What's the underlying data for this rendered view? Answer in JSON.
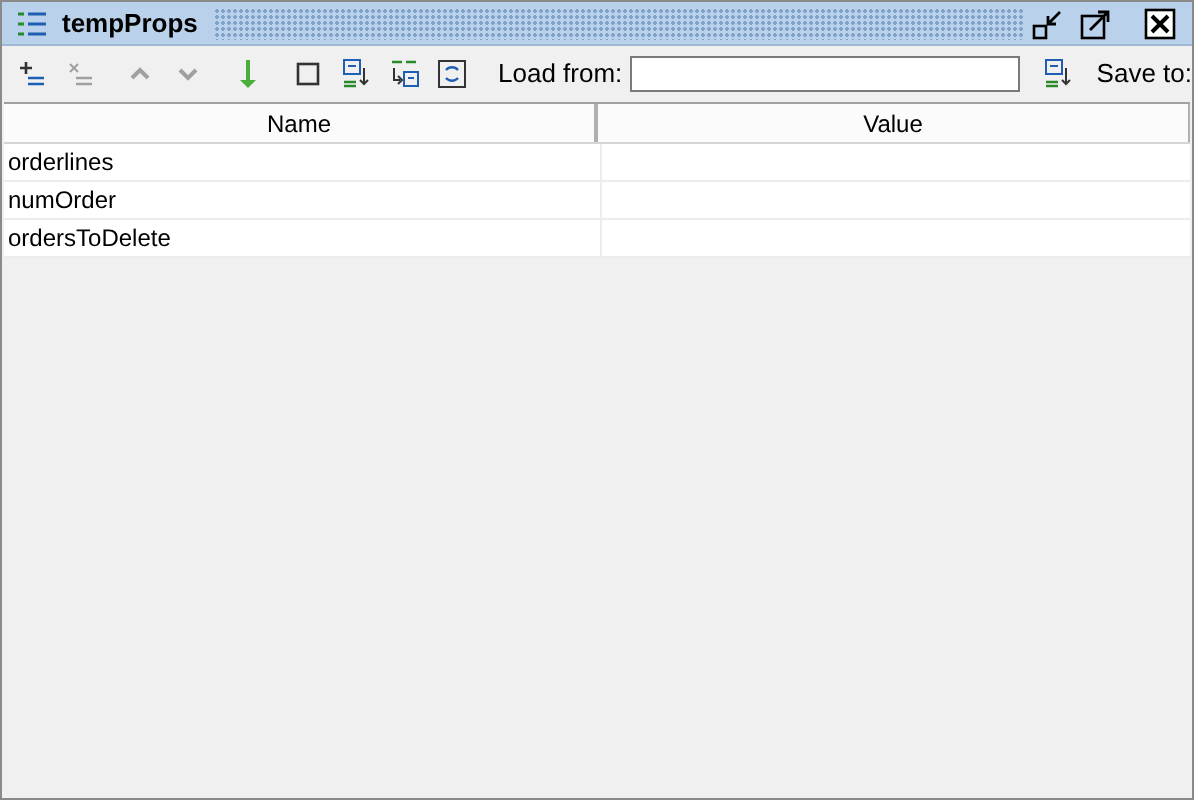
{
  "window": {
    "title": "tempProps"
  },
  "toolbar": [
    {
      "kind": "add",
      "disabled": false
    },
    {
      "kind": "remove",
      "disabled": true
    },
    {
      "kind": "up",
      "disabled": true
    },
    {
      "kind": "down",
      "disabled": true
    },
    {
      "kind": "download",
      "disabled": false
    },
    {
      "kind": "square",
      "disabled": false
    },
    {
      "kind": "load",
      "disabled": false
    },
    {
      "kind": "swap",
      "disabled": false
    },
    {
      "kind": "refresh",
      "disabled": false
    }
  ],
  "load_from": {
    "label": "Load from:"
  },
  "save_to": {
    "label": "Save to:"
  },
  "table": {
    "columns": [
      "Name",
      "Value"
    ],
    "rows": [
      {
        "name": "orderlines"
      },
      {
        "name": "numOrder"
      },
      {
        "name": "ordersToDelete"
      }
    ]
  }
}
